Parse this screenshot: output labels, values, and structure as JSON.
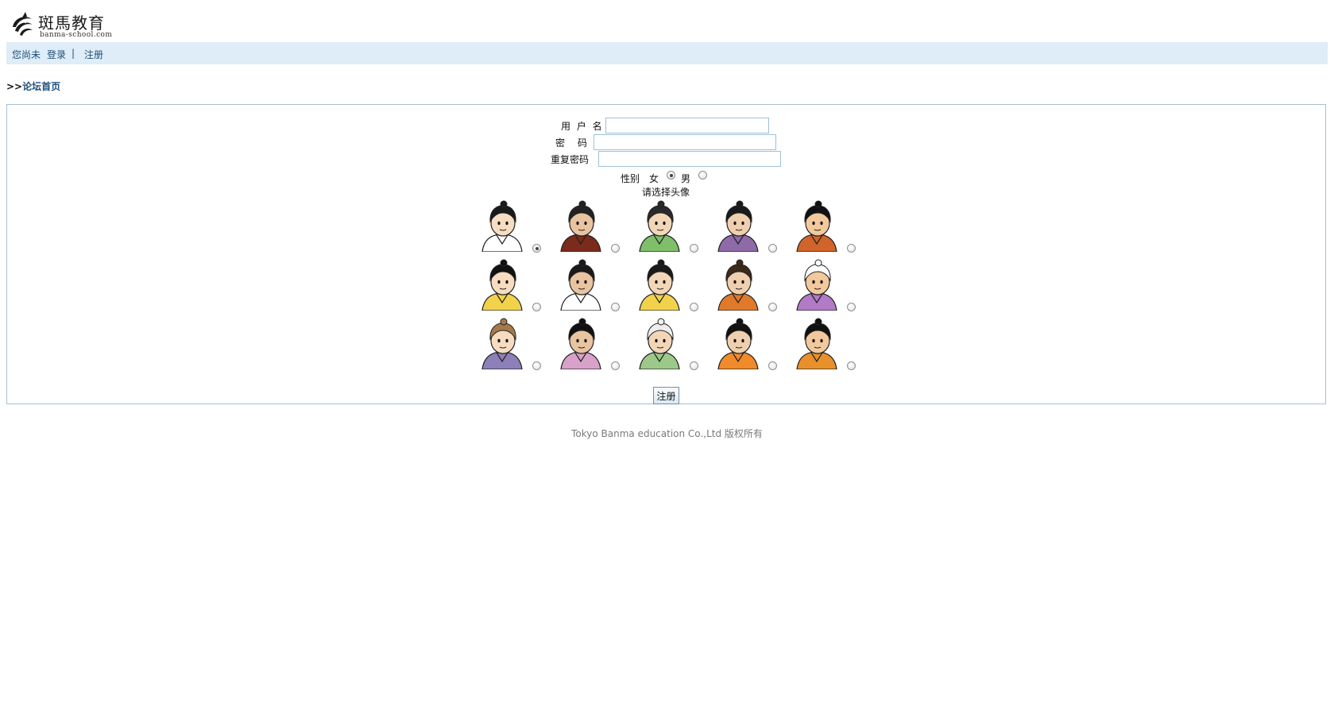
{
  "header": {
    "logo_title": "斑馬教育",
    "logo_subtitle": "banma-school.com"
  },
  "topbar": {
    "status_text": "您尚未",
    "login_label": "登录",
    "separator": "|",
    "register_label": "注册"
  },
  "breadcrumb": {
    "arrows": ">>",
    "home_label": "论坛首页"
  },
  "form": {
    "username_label": "用 户 名",
    "username_value": "",
    "password_label": "密　码",
    "password_value": "",
    "repeat_password_label": "重复密码",
    "repeat_password_value": "",
    "gender_label": "性别",
    "gender_female_label": "女",
    "gender_male_label": "男",
    "gender_selected": "female",
    "avatar_prompt": "请选择头像",
    "avatar_selected_index": 0,
    "avatar_names": [
      "avatar-1",
      "avatar-2",
      "avatar-3",
      "avatar-4",
      "avatar-5",
      "avatar-6",
      "avatar-7",
      "avatar-8",
      "avatar-9",
      "avatar-10",
      "avatar-11",
      "avatar-12",
      "avatar-13",
      "avatar-14",
      "avatar-15"
    ],
    "submit_label": "注册"
  },
  "footer": {
    "copyright": "Tokyo Banma education Co.,Ltd 版权所有"
  },
  "colors": {
    "topbar_bg": "#deedf7",
    "link": "#1f4e79",
    "panel_border": "#a7c0d4",
    "field_border": "#9fc0d6"
  }
}
